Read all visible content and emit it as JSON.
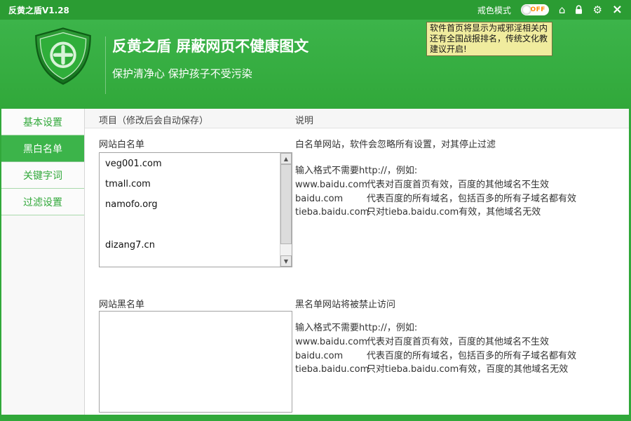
{
  "colors": {
    "green_dark": "#2b9c33",
    "green_main": "#31a83a",
    "green_light": "#3cb44a",
    "tooltip_bg": "#f0ec9e",
    "off_orange": "#ff8a00"
  },
  "titlebar": {
    "app_title": "反黄之盾V1.28",
    "mode_label": "戒色模式",
    "toggle_state": "OFF",
    "icons": [
      "home-icon",
      "lock-icon",
      "gear-icon",
      "close-icon"
    ]
  },
  "header": {
    "title": "反黄之盾 屏蔽网页不健康图文",
    "subtitle": "保护清净心 保护孩子不受污染",
    "tooltip_lines": [
      "软件首页将显示为戒邪淫相关内",
      "还有全国战报排名，传统文化教",
      "建议开启!"
    ]
  },
  "sidebar": {
    "items": [
      {
        "label": "基本设置",
        "active": false
      },
      {
        "label": "黑白名单",
        "active": true
      },
      {
        "label": "关键字词",
        "active": false
      },
      {
        "label": "过滤设置",
        "active": false
      }
    ]
  },
  "main": {
    "columns": {
      "items_header": "项目（修改后会自动保存）",
      "desc_header": "说明"
    },
    "whitelist": {
      "label": "网站白名单",
      "entries": [
        "veg001.com",
        "tmall.com",
        "namofo.org",
        "",
        "dizang7.cn"
      ],
      "desc_title": "白名单网站，软件会忽略所有设置，对其停止过滤",
      "format_hint": "输入格式不需要http://，例如:",
      "examples": [
        {
          "domain": "www.baidu.com",
          "desc": "代表对百度首页有效，百度的其他域名不生效"
        },
        {
          "domain": "baidu.com",
          "desc": "代表百度的所有域名，包括百多的所有子域名都有效"
        },
        {
          "domain": "tieba.baidu.com",
          "desc": "只对tieba.baidu.com有效，其他域名无效"
        }
      ]
    },
    "blacklist": {
      "label": "网站黑名单",
      "entries": [],
      "desc_title": "黑名单网站将被禁止访问",
      "format_hint": "输入格式不需要http://，例如:",
      "examples": [
        {
          "domain": "www.baidu.com",
          "desc": "代表对百度首页有效，百度的其他域名不生效"
        },
        {
          "domain": "baidu.com",
          "desc": "代表百度的所有域名，包括百多的所有子域名都有效"
        },
        {
          "domain": "tieba.baidu.com",
          "desc": "只对tieba.baidu.com有效，百度的其他域名无效"
        }
      ]
    }
  }
}
